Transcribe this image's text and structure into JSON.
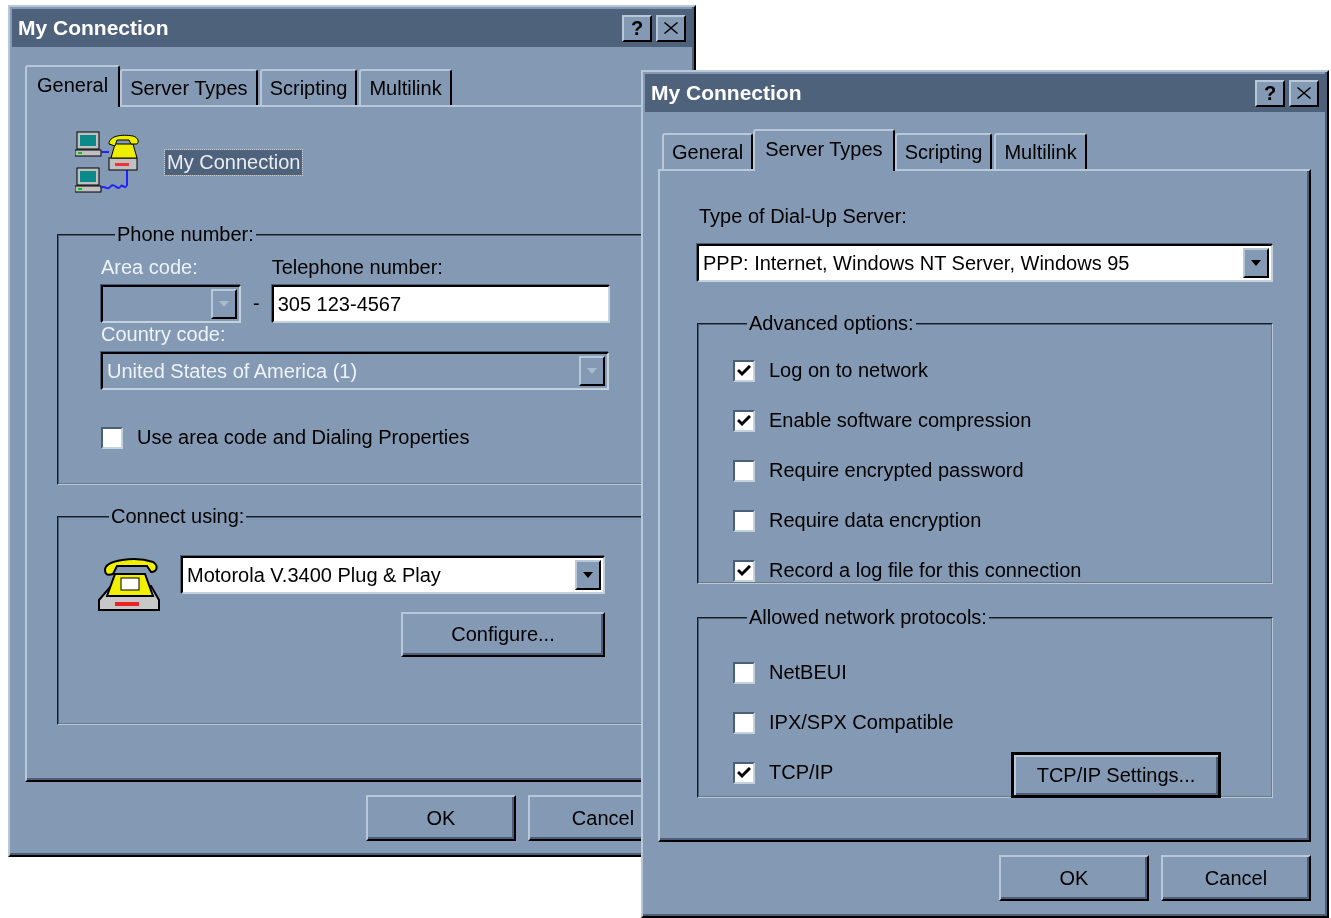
{
  "general_dialog": {
    "title": "My Connection",
    "help_button": "?",
    "tabs": [
      {
        "label": "General",
        "selected": true
      },
      {
        "label": "Server Types",
        "selected": false
      },
      {
        "label": "Scripting",
        "selected": false
      },
      {
        "label": "Multilink",
        "selected": false
      }
    ],
    "connection_name": {
      "value": "My Connection",
      "selected": true
    },
    "phone_group": {
      "label": "Phone number:",
      "area_code": {
        "label": "Area code:",
        "disabled": true
      },
      "separator": "-",
      "telephone": {
        "label": "Telephone number:",
        "value": "305 123-4567"
      },
      "country_code": {
        "label": "Country code:",
        "value": "United States of America (1)",
        "disabled": true
      },
      "use_area_code": {
        "label": "Use area code and Dialing Properties",
        "checked": false
      }
    },
    "connect_group": {
      "label": "Connect using:",
      "modem": "Motorola V.3400 Plug & Play",
      "configure_button": "Configure..."
    },
    "buttons": [
      "OK",
      "Cancel"
    ]
  },
  "server_types_dialog": {
    "title": "My Connection",
    "help_button": "?",
    "tabs": [
      {
        "label": "General",
        "selected": false
      },
      {
        "label": "Server Types",
        "selected": true
      },
      {
        "label": "Scripting",
        "selected": false
      },
      {
        "label": "Multilink",
        "selected": false
      }
    ],
    "server_type": {
      "label": "Type of Dial-Up Server:",
      "value": "PPP: Internet, Windows NT Server, Windows 95"
    },
    "advanced_options": {
      "label": "Advanced options:",
      "options": [
        {
          "label": "Log on to network",
          "checked": true
        },
        {
          "label": "Enable software compression",
          "checked": true
        },
        {
          "label": "Require encrypted password",
          "checked": false
        },
        {
          "label": "Require data encryption",
          "checked": false
        },
        {
          "label": "Record a log file for this connection",
          "checked": true
        }
      ]
    },
    "protocols": {
      "label": "Allowed network protocols:",
      "options": [
        {
          "label": "NetBEUI",
          "checked": false
        },
        {
          "label": "IPX/SPX Compatible",
          "checked": false
        },
        {
          "label": "TCP/IP",
          "checked": true
        }
      ],
      "settings_button": "TCP/IP Settings..."
    },
    "buttons": [
      "OK",
      "Cancel"
    ]
  }
}
